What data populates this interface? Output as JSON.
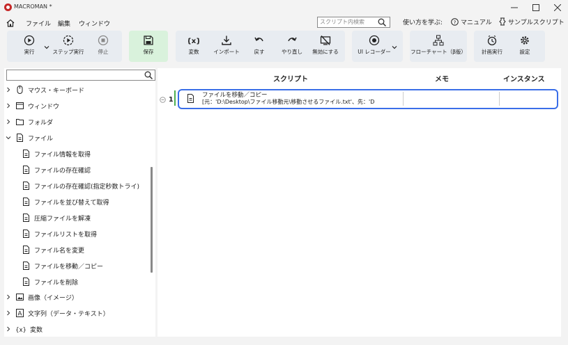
{
  "window": {
    "title": "MACROMAN *"
  },
  "menu": {
    "items": [
      "ファイル",
      "編集",
      "ウィンドウ"
    ]
  },
  "search": {
    "placeholder": "スクリプト内検索"
  },
  "help": {
    "learn": "使い方を学ぶ:",
    "manual": "マニュアル",
    "samples": "サンプルスクリプト"
  },
  "toolbar": {
    "run": "実行",
    "step": "ステップ実行",
    "stop": "停止",
    "save": "保存",
    "variable": "変数",
    "import": "インポート",
    "undo": "戻す",
    "redo": "やり直し",
    "disable": "無効にする",
    "ui_recorder": "UI レコーダー",
    "flowchart": "フローチャート（β版）",
    "schedule": "計画実行",
    "settings": "設定"
  },
  "tree": {
    "items": [
      {
        "label": "マウス・キーボード",
        "icon": "mouse-icon"
      },
      {
        "label": "ウィンドウ",
        "icon": "window-icon"
      },
      {
        "label": "フォルダ",
        "icon": "folder-icon"
      },
      {
        "label": "ファイル",
        "icon": "file-icon",
        "expanded": true
      },
      {
        "label": "ファイル情報を取得",
        "icon": "file-icon"
      },
      {
        "label": "ファイルの存在確認",
        "icon": "file-icon"
      },
      {
        "label": "ファイルの存在確認(指定秒数トライ)",
        "icon": "file-icon"
      },
      {
        "label": "ファイルを並び替えて取得",
        "icon": "file-icon"
      },
      {
        "label": "圧縮ファイルを解凍",
        "icon": "file-icon"
      },
      {
        "label": "ファイルリストを取得",
        "icon": "file-icon"
      },
      {
        "label": "ファイル名を変更",
        "icon": "file-icon"
      },
      {
        "label": "ファイルを移動／コピー",
        "icon": "file-icon"
      },
      {
        "label": "ファイルを削除",
        "icon": "file-icon"
      },
      {
        "label": "画像（イメージ）",
        "icon": "image-icon"
      },
      {
        "label": "文字列（データ・テキスト）",
        "icon": "text-icon"
      },
      {
        "label": "変数",
        "icon": "variable-icon"
      }
    ]
  },
  "columns": {
    "script": "スクリプト",
    "memo": "メモ",
    "instance": "インスタンス"
  },
  "script_rows": [
    {
      "number": "1",
      "title": "ファイルを移動／コピー",
      "detail": "[元：'D:\\Desktop\\ファイル移動元\\移動させるファイル.txt'、先：'D"
    }
  ],
  "colors": {
    "accent": "#3a6ee8",
    "save_bg": "#d9f2dc",
    "group_bg": "#e8ecf1",
    "logo": "#c62828"
  }
}
